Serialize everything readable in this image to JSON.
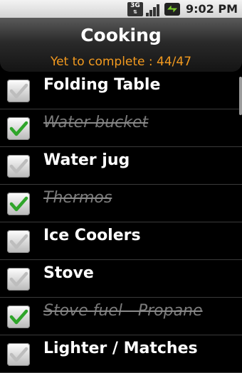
{
  "status_bar": {
    "network": "3G",
    "time": "9:02 PM"
  },
  "header": {
    "title": "Cooking",
    "progress": "Yet to complete : 44/47"
  },
  "items": [
    {
      "label": "Folding Table",
      "checked": false
    },
    {
      "label": "Water bucket",
      "checked": true
    },
    {
      "label": "Water jug",
      "checked": false
    },
    {
      "label": "Thermos",
      "checked": true
    },
    {
      "label": "Ice Coolers",
      "checked": false
    },
    {
      "label": "Stove",
      "checked": false
    },
    {
      "label": "Stove fuel - Propane",
      "checked": true
    },
    {
      "label": "Lighter / Matches",
      "checked": false
    }
  ],
  "colors": {
    "accent_progress": "#f39a1f",
    "check_green": "#2fa52a",
    "check_grey": "#bdbdbd"
  }
}
